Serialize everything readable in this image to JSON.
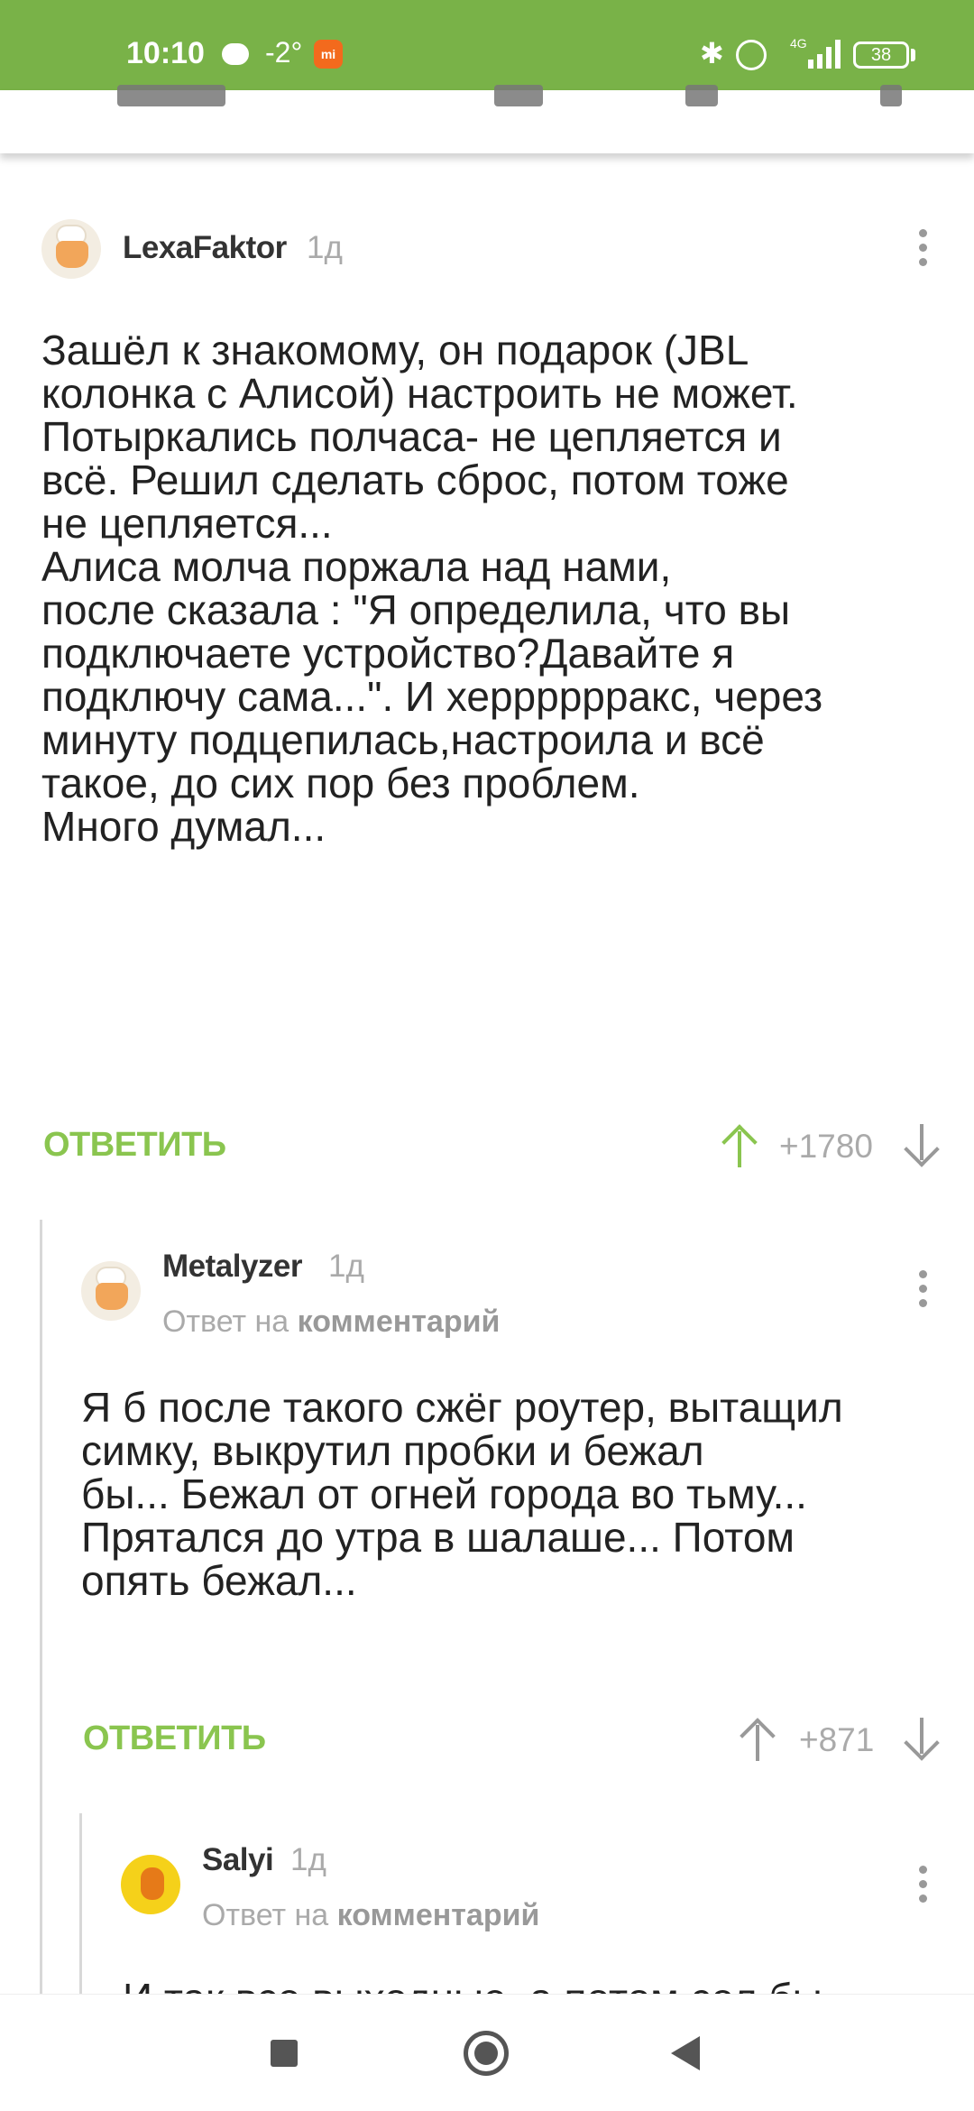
{
  "status_bar": {
    "time": "10:10",
    "temperature": "-2°",
    "network": "4G",
    "battery": "38"
  },
  "comments": [
    {
      "author": "LexaFaktor",
      "age": "1д",
      "body_lines": [
        "Зашёл к знакомому, он подарок (JBL",
        "колонка с Алисой) настроить не может.",
        "Потыркались полчаса- не цепляется и",
        "всё. Решил сделать сброс, потом тоже",
        "не цепляется...",
        "Алиса молча поржала над нами,",
        "после сказала : \"Я определила, что вы",
        "подключаете устройство?Давайте я",
        "подключу сама...\". И херррррракс, через",
        "минуту подцепилась,настроила и всё",
        "такое, до сих пор без проблем.",
        "Много думал..."
      ],
      "reply_label": "ОТВЕТИТЬ",
      "score": "+1780"
    },
    {
      "author": "Metalyzer",
      "age": "1д",
      "reply_to_prefix": "Ответ на",
      "reply_to_link": "комментарий",
      "body_lines": [
        "Я б после такого сжёг роутер, вытащил",
        "симку, выкрутил пробки и бежал",
        "бы... Бежал от огней города во тьму...",
        "Прятался до утра в шалаше... Потом",
        "опять бежал..."
      ],
      "reply_label": "ОТВЕТИТЬ",
      "score": "+871"
    },
    {
      "author": "Salyi",
      "age": "1д",
      "reply_to_prefix": "Ответ на",
      "reply_to_link": "комментарий",
      "cut_line": "И так все выходные, а потом сел бы"
    }
  ],
  "colors": {
    "accent": "#79b248",
    "reply": "#8ac54f",
    "upvoted": "#8ac54f",
    "muted": "#aaaaaa"
  }
}
